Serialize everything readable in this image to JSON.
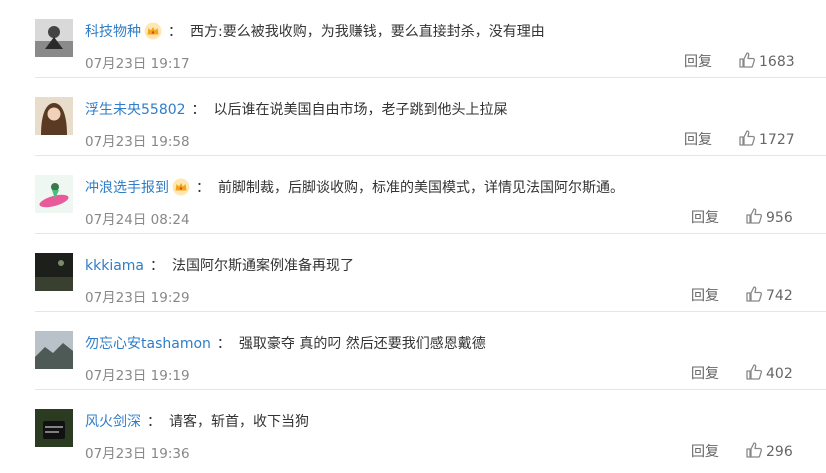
{
  "comments": [
    {
      "username": "科技物种",
      "badge": "crown-icon",
      "text": "西方:要么被我收购，为我赚钱，要么直接封杀，没有理由",
      "time": "07月23日 19:17",
      "reply_label": "回复",
      "likes": "1683"
    },
    {
      "username": "浮生未央55802",
      "badge": null,
      "text": "以后谁在说美国自由市场，老子跳到他头上拉屎",
      "time": "07月23日 19:58",
      "reply_label": "回复",
      "likes": "1727"
    },
    {
      "username": "冲浪选手报到",
      "badge": "crown-icon",
      "text": "前脚制裁，后脚谈收购，标准的美国模式，详情见法国阿尔斯通。",
      "time": "07月24日 08:24",
      "reply_label": "回复",
      "likes": "956"
    },
    {
      "username": "kkkiama",
      "badge": null,
      "text": "法国阿尔斯通案例准备再现了",
      "time": "07月23日 19:29",
      "reply_label": "回复",
      "likes": "742"
    },
    {
      "username": "勿忘心安tashamon",
      "badge": null,
      "text": "强取豪夺 真的叼 然后还要我们感恩戴德",
      "time": "07月23日 19:19",
      "reply_label": "回复",
      "likes": "402"
    },
    {
      "username": "风火剑深",
      "badge": null,
      "text": "请客，斩首，收下当狗",
      "time": "07月23日 19:36",
      "reply_label": "回复",
      "likes": "296"
    }
  ],
  "colors": {
    "username": "#2f7dc8",
    "text": "#333333",
    "meta": "#888888",
    "divider": "#e6e6e6"
  }
}
